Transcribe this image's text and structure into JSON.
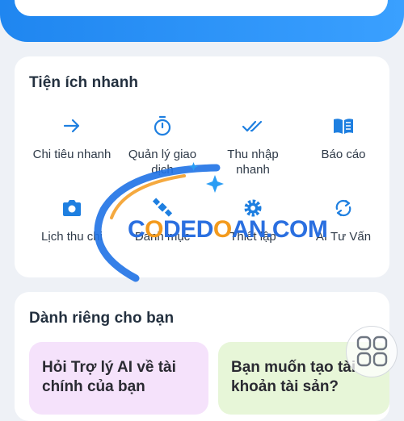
{
  "colors": {
    "accent": "#1f86f0",
    "icon": "#1e7fe0",
    "ai_chip": "#f5e2fb",
    "asset_chip": "#e7f6d8",
    "watermark_blue": "#2a6fe0",
    "watermark_orange": "#f39a1d"
  },
  "quick_actions": {
    "title": "Tiện ích nhanh",
    "items": [
      {
        "label": "Chi tiêu nhanh",
        "icon": "arrow-right-icon"
      },
      {
        "label": "Quản lý giao dịch",
        "icon": "stopwatch-icon"
      },
      {
        "label": "Thu nhập nhanh",
        "icon": "double-check-icon"
      },
      {
        "label": "Báo cáo",
        "icon": "book-icon"
      },
      {
        "label": "Lịch thu chi",
        "icon": "camera-icon"
      },
      {
        "label": "Danh mục",
        "icon": "satellite-icon"
      },
      {
        "label": "Thiết lập",
        "icon": "gear-icon"
      },
      {
        "label": "AI Tư Vấn",
        "icon": "refresh-icon"
      }
    ]
  },
  "for_you": {
    "title": "Dành riêng cho bạn",
    "cards": [
      {
        "label": "Hỏi Trợ lý AI về tài chính của bạn"
      },
      {
        "label": "Bạn muốn tạo tài khoản tài sản?"
      }
    ]
  },
  "watermark": {
    "prefix": "C",
    "o1": "O",
    "middle": "DED",
    "o2": "O",
    "suffix": "AN.COM"
  }
}
